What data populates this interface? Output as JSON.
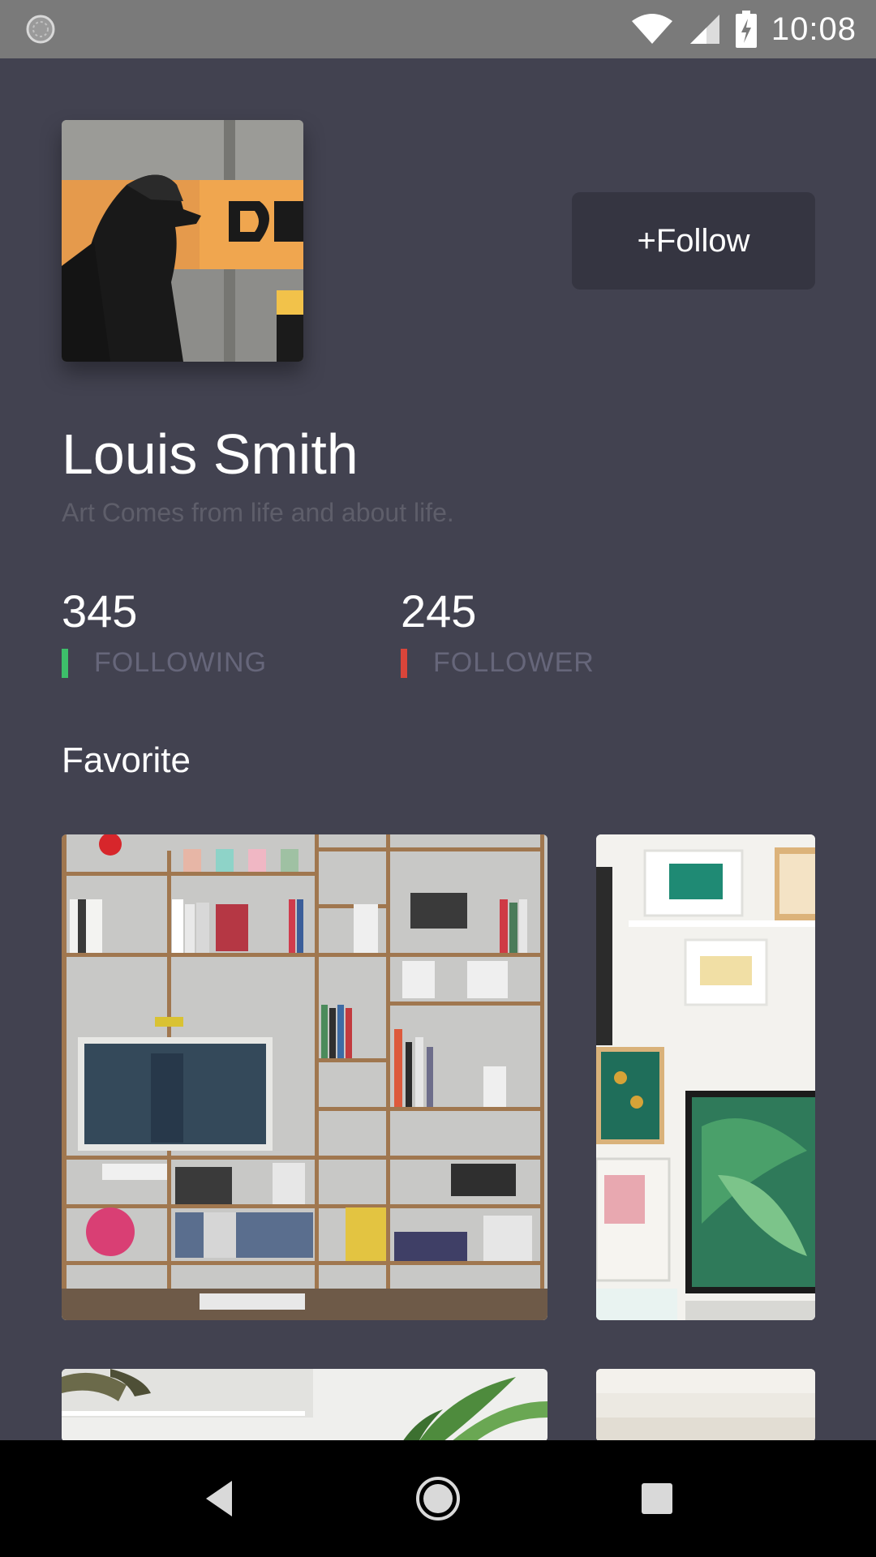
{
  "status_bar": {
    "time": "10:08",
    "icons": [
      "sync-icon",
      "wifi-icon",
      "signal-icon",
      "battery-charging-icon"
    ]
  },
  "profile": {
    "name": "Louis Smith",
    "bio": "Art Comes from life and about life.",
    "follow_label": "+Follow",
    "avatar_icon": "avatar-photo"
  },
  "stats": [
    {
      "value": "345",
      "label": "FOLLOWING",
      "color": "#3dbf6a"
    },
    {
      "value": "245",
      "label": "FOLLOWER",
      "color": "#d9453a"
    }
  ],
  "favorites": {
    "title": "Favorite",
    "items": [
      "bookshelf-photo",
      "gallery-wall-photo",
      "plant-photo",
      "interior-photo"
    ]
  },
  "nav_bar": {
    "icons": [
      "back-icon",
      "home-icon",
      "recents-icon"
    ]
  },
  "colors": {
    "background": "#424250",
    "button": "#353541",
    "status_bar": "#7a7a7a",
    "nav_bar": "#000000"
  }
}
